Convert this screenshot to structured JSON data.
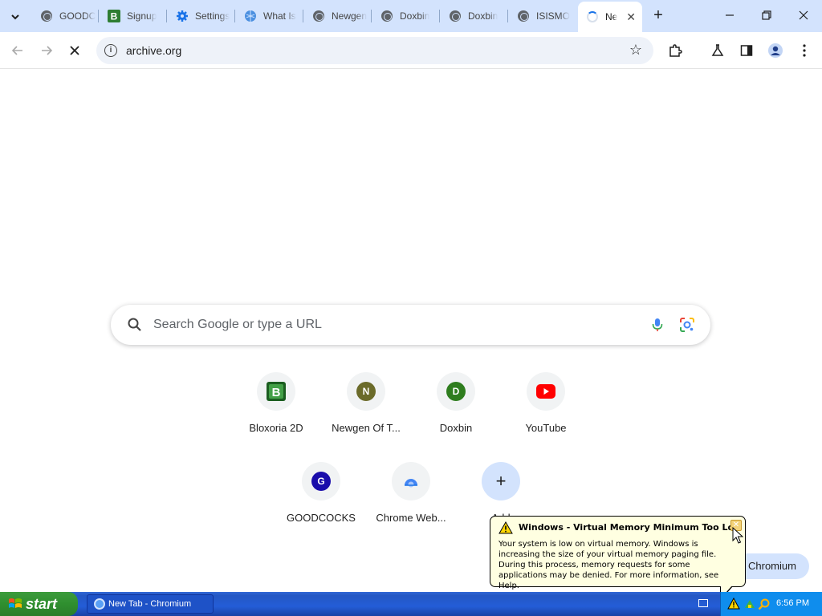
{
  "tabs": [
    {
      "title": "GOODC",
      "favicon": "globe-icon"
    },
    {
      "title": "Signup",
      "favicon": "bloxoria-icon"
    },
    {
      "title": "Settings",
      "favicon": "gear-icon"
    },
    {
      "title": "What Is",
      "favicon": "globe-blue-icon"
    },
    {
      "title": "Newgen",
      "favicon": "globe-icon"
    },
    {
      "title": "Doxbin",
      "favicon": "globe-icon"
    },
    {
      "title": "Doxbin",
      "favicon": "globe-icon"
    },
    {
      "title": "ISISMO",
      "favicon": "globe-icon"
    },
    {
      "title": "Ne",
      "favicon": "loading-spinner-icon",
      "active": true
    }
  ],
  "omnibox": {
    "url": "archive.org"
  },
  "search": {
    "placeholder": "Search Google or type a URL"
  },
  "shortcuts": [
    {
      "label": "Bloxoria 2D",
      "badge": "B",
      "color": "#2e7d32"
    },
    {
      "label": "Newgen Of T...",
      "badge": "N",
      "color": "#6b6b2a"
    },
    {
      "label": "Doxbin",
      "badge": "D",
      "color": "#2e7d1e"
    },
    {
      "label": "YouTube",
      "badge": "▶",
      "color": "#ff0000"
    },
    {
      "label": "GOODCOCKS",
      "badge": "G",
      "color": "#1a0dab"
    },
    {
      "label": "Chrome Web...",
      "badge": "",
      "color": "#4285f4"
    },
    {
      "label": "Add",
      "badge": "+",
      "color": "#1f1f1f"
    }
  ],
  "customize": {
    "label": "Chromium"
  },
  "balloon": {
    "title": "Windows - Virtual Memory Minimum Too Low",
    "body": "Your system is low on virtual memory. Windows is increasing the size of your virtual memory paging file. During this process, memory requests for some applications may be denied. For more information, see Help."
  },
  "taskbar": {
    "start": "start",
    "task": "New Tab - Chromium",
    "clock": "6:56 PM"
  }
}
